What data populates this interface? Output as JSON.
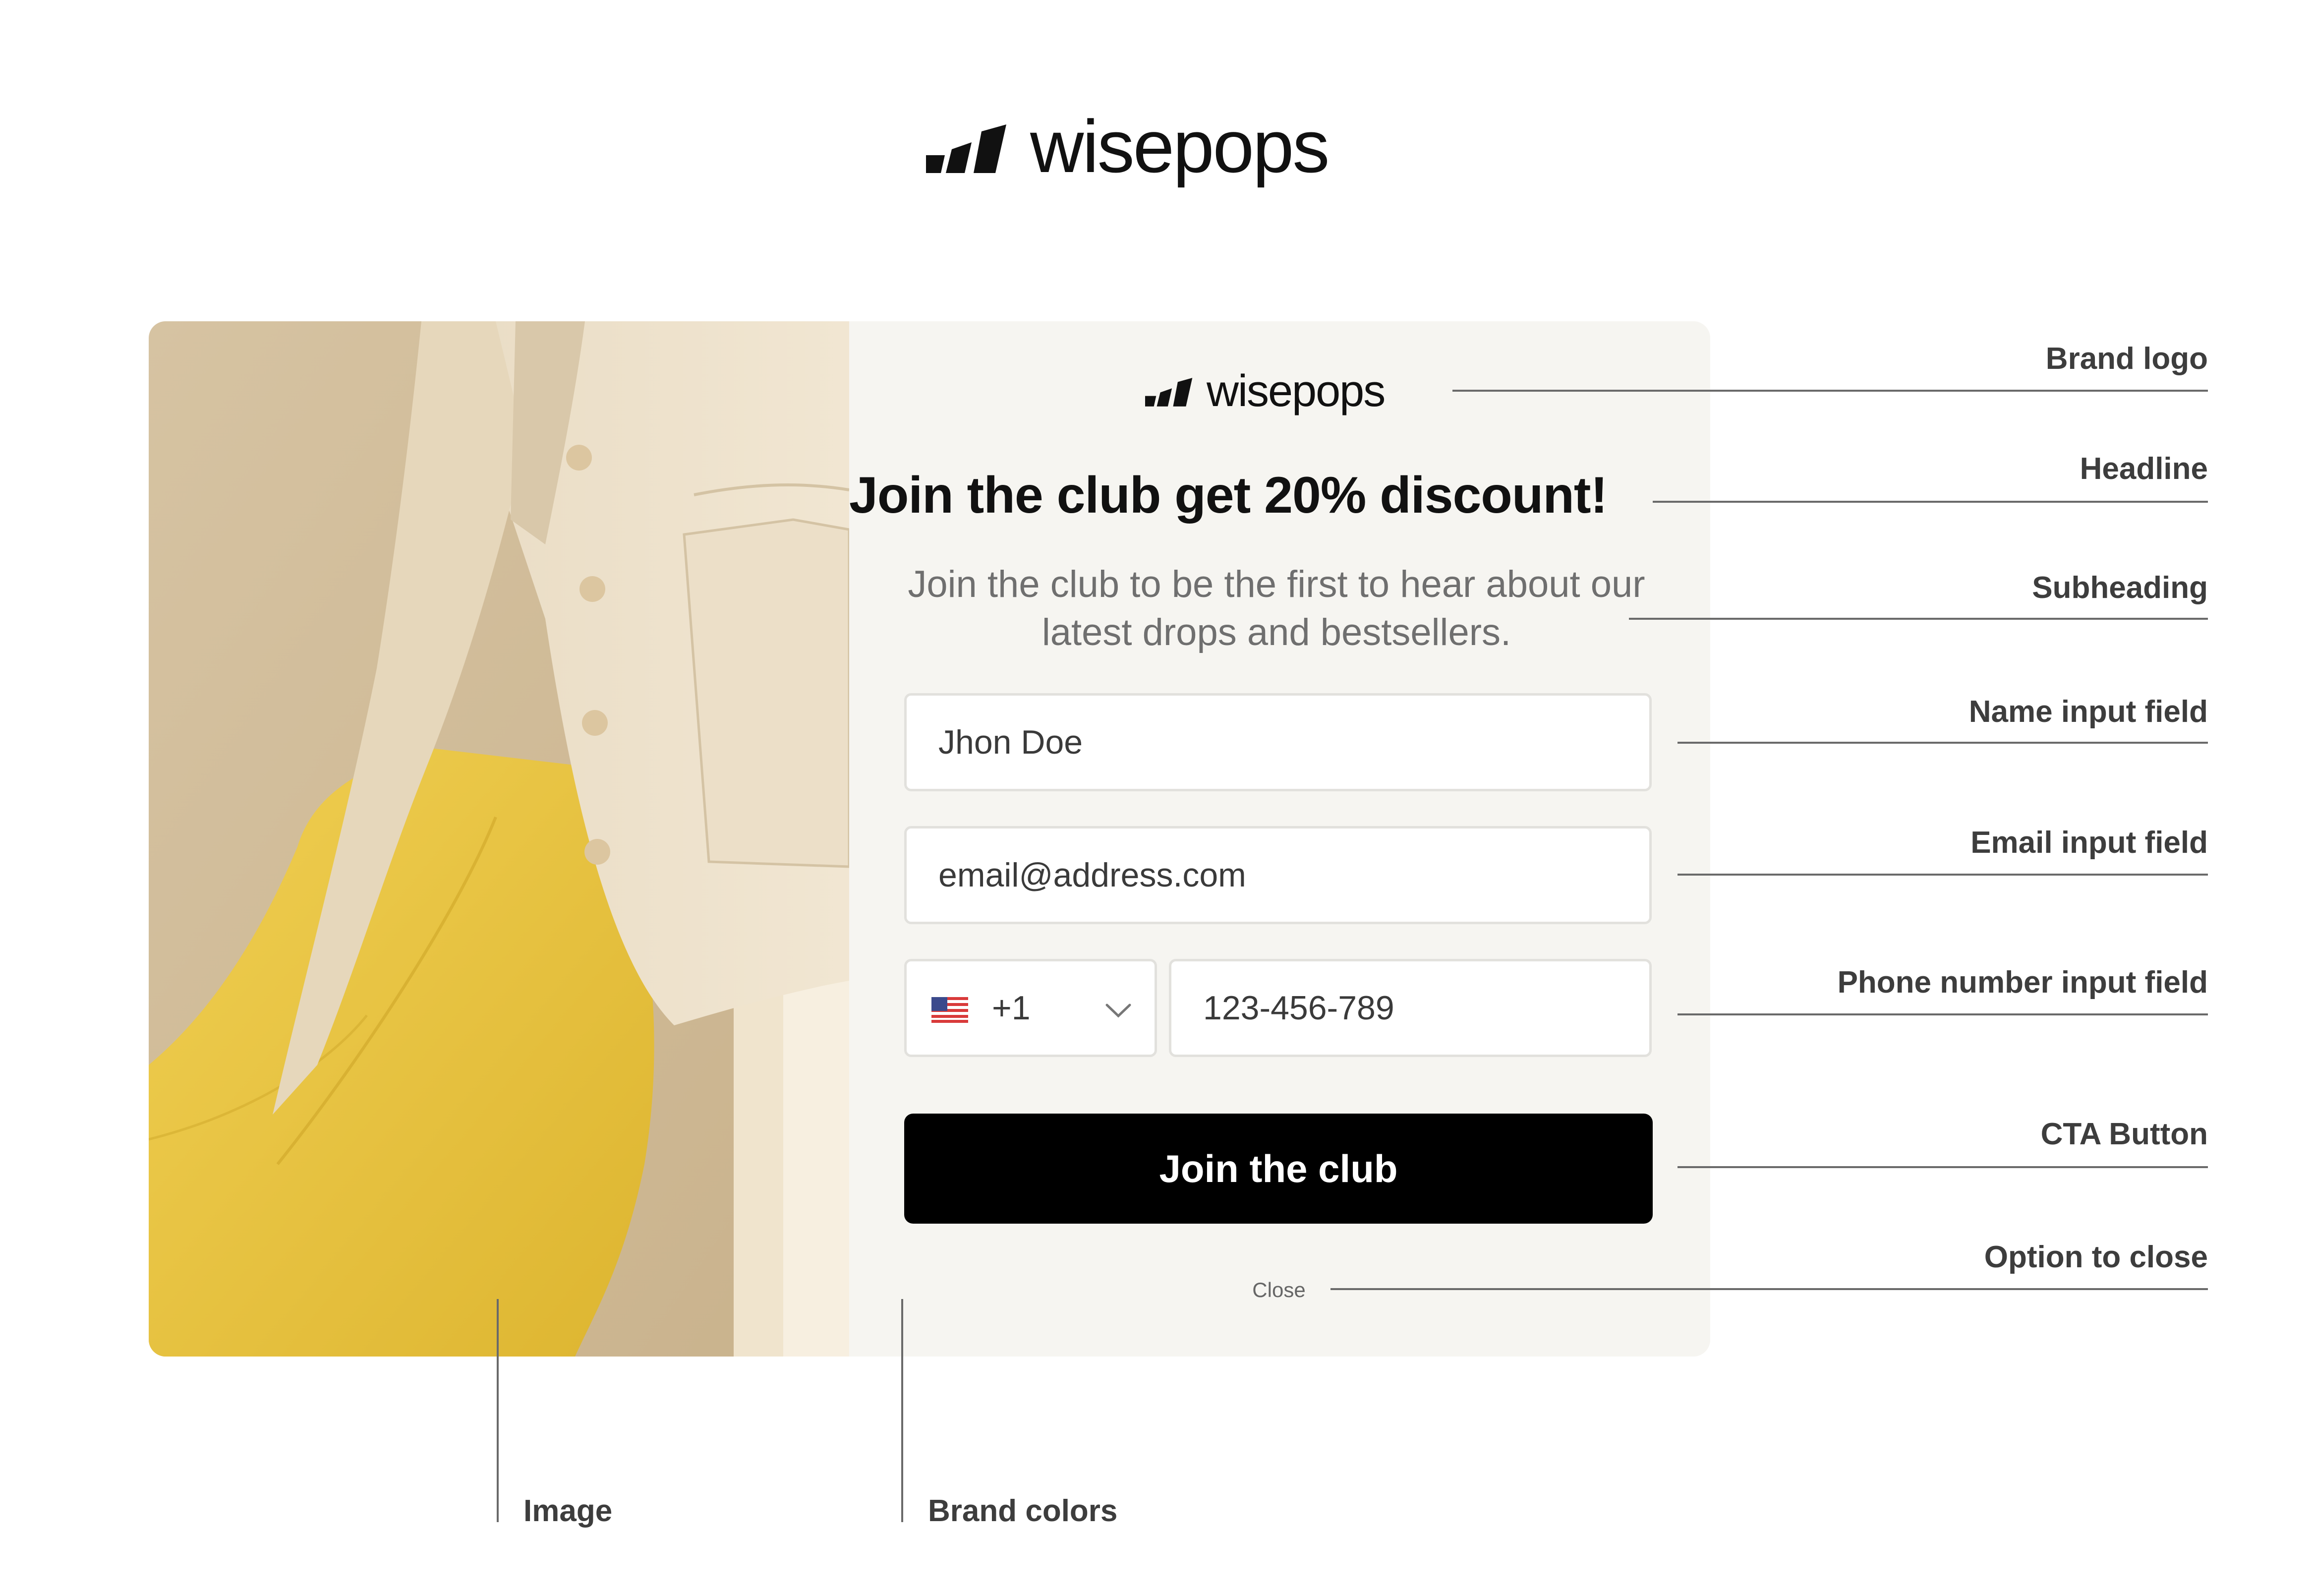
{
  "brand": {
    "name": "wisepops",
    "logo_icon": "wisepops-mark-icon"
  },
  "popup": {
    "headline": "Join the club get 20% discount!",
    "subheading": "Join the club to be the first to hear about our latest drops and bestsellers.",
    "name_field": {
      "value": "Jhon Doe"
    },
    "email_field": {
      "value": "email@address.com"
    },
    "phone": {
      "country_flag": "us-flag-icon",
      "country_code": "+1",
      "chevron": "chevron-down-icon",
      "number": "123-456-789"
    },
    "cta_label": "Join the club",
    "close_label": "Close",
    "colors": {
      "cta_bg": "#000000",
      "panel_bg": "#f6f5f1",
      "field_border": "#e2e1dd"
    }
  },
  "annotations": {
    "brand_logo": "Brand logo",
    "headline": "Headline",
    "subheading": "Subheading",
    "name_input": "Name input field",
    "email_input": "Email input field",
    "phone_input": "Phone number input field",
    "cta_button": "CTA Button",
    "option_to_close": "Option to close",
    "image": "Image",
    "brand_colors": "Brand colors"
  }
}
